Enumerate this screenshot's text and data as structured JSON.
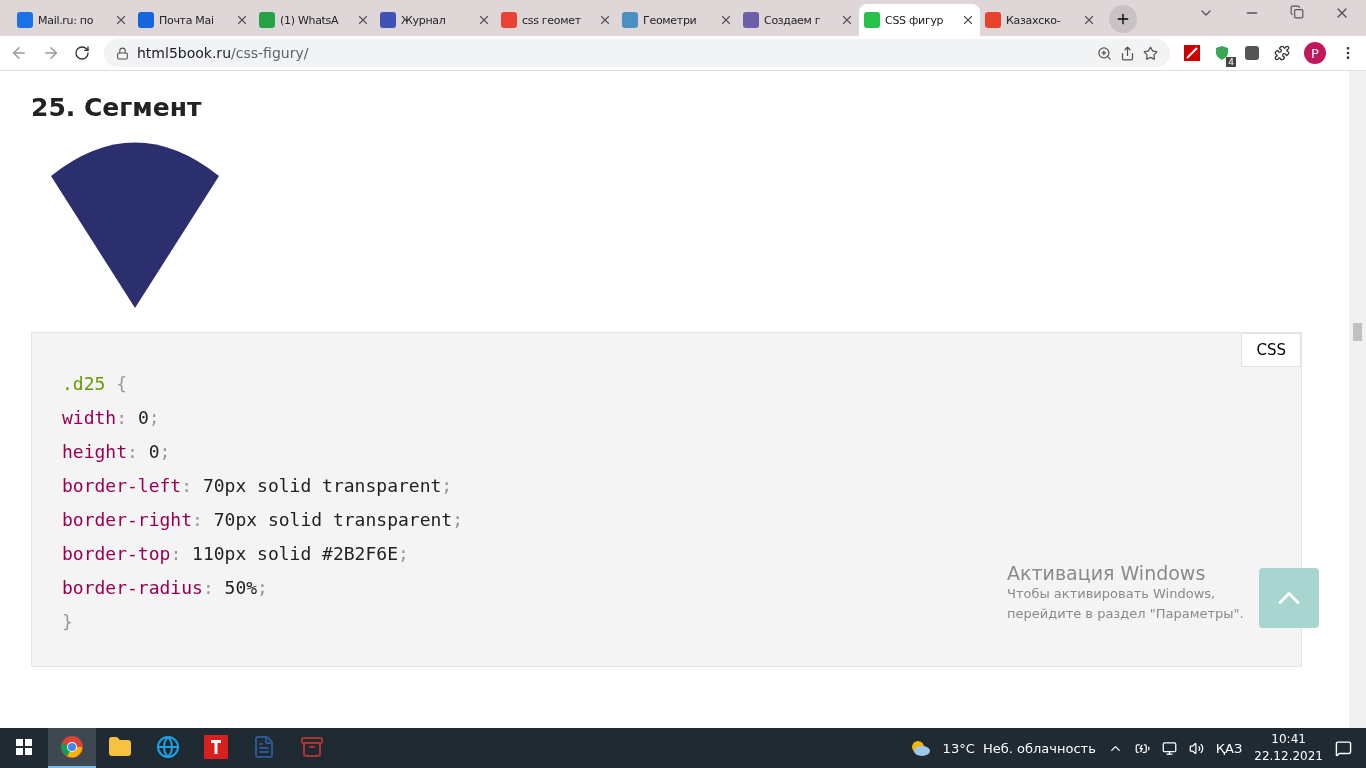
{
  "tabs": [
    {
      "title": "Mail.ru: по",
      "color": "#1a73e8",
      "selected": false
    },
    {
      "title": "Почта Mai",
      "color": "#1565e0",
      "selected": false
    },
    {
      "title": "(1) WhatsA",
      "color": "#25a244",
      "selected": false
    },
    {
      "title": "Журнал",
      "color": "#3f51b5",
      "selected": false
    },
    {
      "title": "css геомет",
      "color": "#ea4335",
      "selected": false
    },
    {
      "title": "Геометри",
      "color": "#4a90c0",
      "selected": false
    },
    {
      "title": "Создаем г",
      "color": "#6a5fa8",
      "selected": false
    },
    {
      "title": "CSS фигур",
      "color": "#27c24c",
      "selected": true
    },
    {
      "title": "Казахско-",
      "color": "#e8412c",
      "selected": false
    }
  ],
  "address": {
    "host": "html5book.ru",
    "path": "/css-figury/"
  },
  "profile": "P",
  "extension_badge": "4",
  "heading": "25. Сегмент",
  "code": {
    "language": "CSS",
    "lines": [
      [
        {
          "kind": "selector",
          "text": ".d25 "
        },
        {
          "kind": "punct",
          "text": "{"
        }
      ],
      [
        {
          "kind": "property",
          "text": "width"
        },
        {
          "kind": "punct",
          "text": ": "
        },
        {
          "kind": "value",
          "text": "0"
        },
        {
          "kind": "punct",
          "text": ";"
        }
      ],
      [
        {
          "kind": "property",
          "text": "height"
        },
        {
          "kind": "punct",
          "text": ": "
        },
        {
          "kind": "value",
          "text": "0"
        },
        {
          "kind": "punct",
          "text": ";"
        }
      ],
      [
        {
          "kind": "property",
          "text": "border-left"
        },
        {
          "kind": "punct",
          "text": ": "
        },
        {
          "kind": "value",
          "text": "70px solid transparent"
        },
        {
          "kind": "punct",
          "text": ";"
        }
      ],
      [
        {
          "kind": "property",
          "text": "border-right"
        },
        {
          "kind": "punct",
          "text": ": "
        },
        {
          "kind": "value",
          "text": "70px solid transparent"
        },
        {
          "kind": "punct",
          "text": ";"
        }
      ],
      [
        {
          "kind": "property",
          "text": "border-top"
        },
        {
          "kind": "punct",
          "text": ": "
        },
        {
          "kind": "value",
          "text": "110px solid #2B2F6E"
        },
        {
          "kind": "punct",
          "text": ";"
        }
      ],
      [
        {
          "kind": "property",
          "text": "border-radius"
        },
        {
          "kind": "punct",
          "text": ": "
        },
        {
          "kind": "value",
          "text": "50%"
        },
        {
          "kind": "punct",
          "text": ";"
        }
      ],
      [
        {
          "kind": "punct",
          "text": "}"
        }
      ]
    ]
  },
  "activation": {
    "title": "Активация Windows",
    "text": "Чтобы активировать Windows, перейдите в раздел \"Параметры\"."
  },
  "taskbar": {
    "apps": [
      {
        "kind": "chrome",
        "selected": true
      },
      {
        "kind": "folder",
        "selected": false
      },
      {
        "kind": "edge",
        "selected": false
      },
      {
        "kind": "t",
        "selected": false
      },
      {
        "kind": "word",
        "selected": false
      },
      {
        "kind": "archive",
        "selected": false
      }
    ],
    "weather": "13°C  Неб. облачность",
    "language": "ҚАЗ",
    "time": "10:41",
    "date": "22.12.2021"
  }
}
